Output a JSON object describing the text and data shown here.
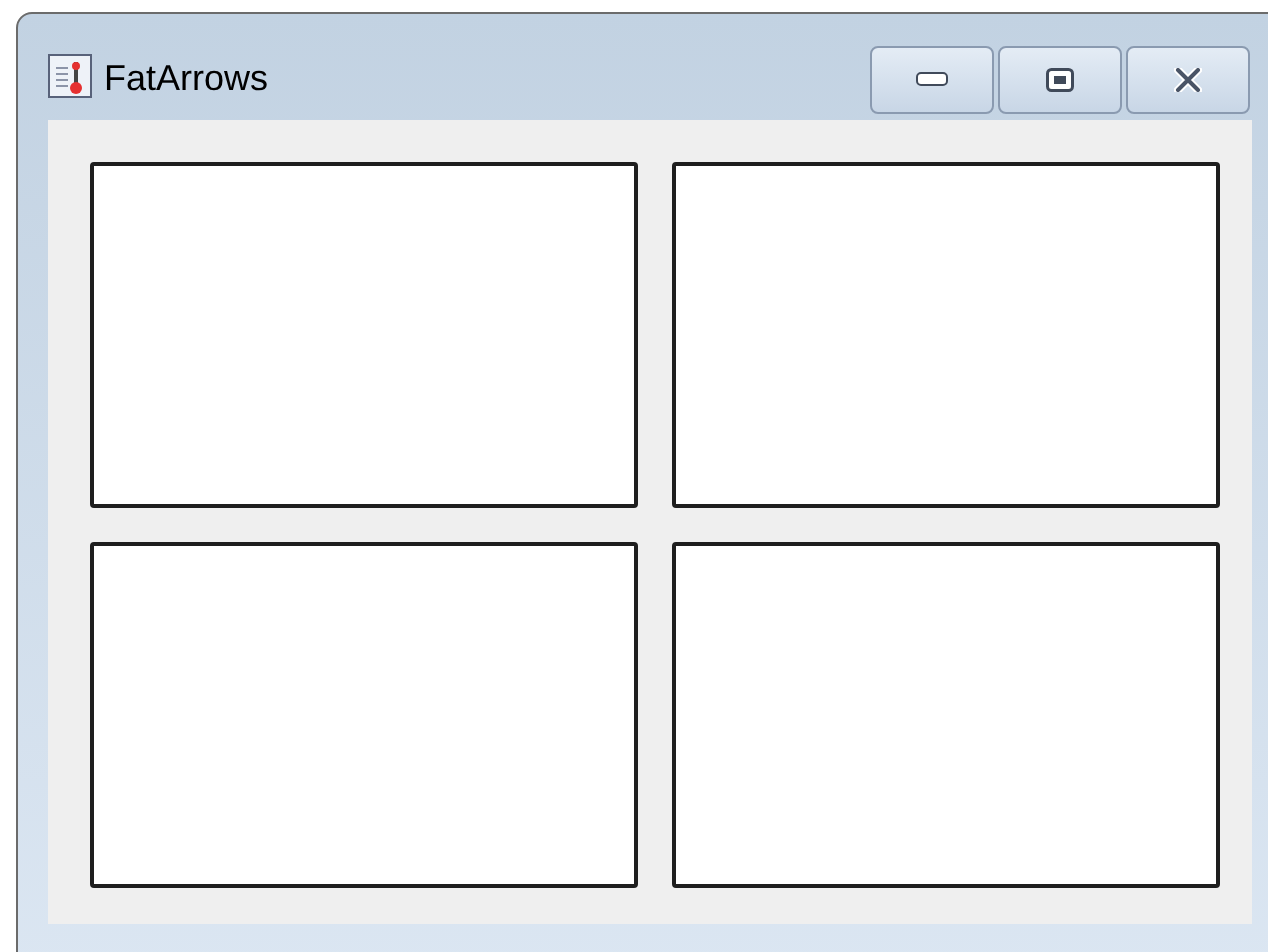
{
  "window": {
    "title": "FatArrows",
    "buttons": [
      {
        "kind": "minimize"
      },
      {
        "kind": "maximize"
      },
      {
        "kind": "close"
      }
    ]
  },
  "panels": [
    {
      "kind": "empty"
    },
    {
      "kind": "empty"
    },
    {
      "kind": "empty"
    },
    {
      "kind": "empty"
    }
  ]
}
